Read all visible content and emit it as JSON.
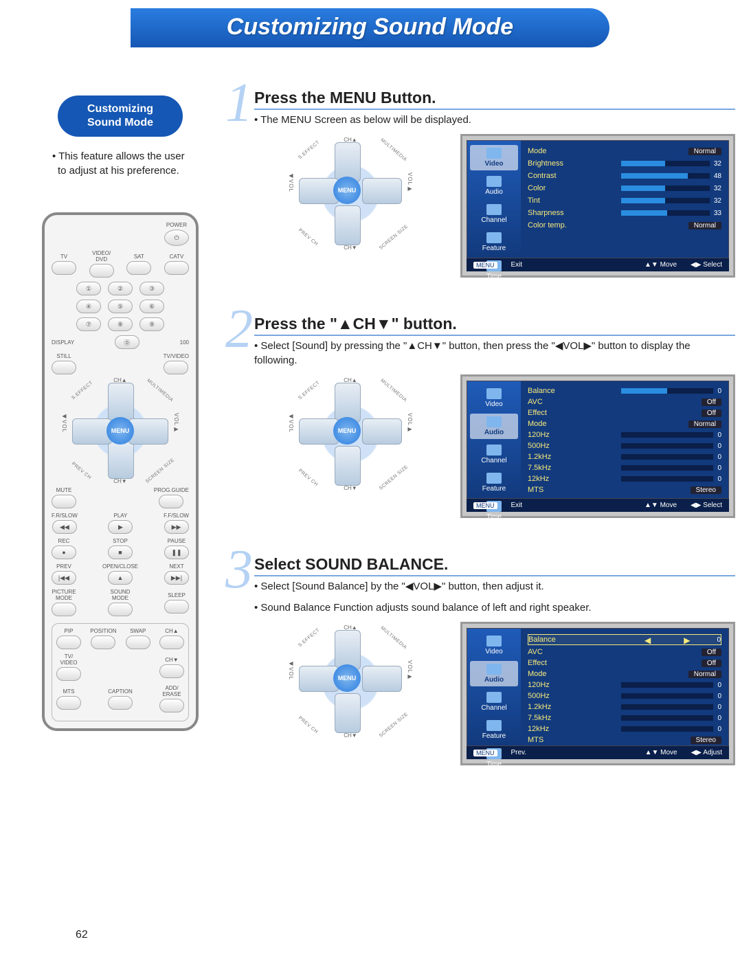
{
  "title": "Customizing Sound Mode",
  "page_number": "62",
  "sidebar": {
    "heading_line1": "Customizing",
    "heading_line2": "Sound Mode",
    "description": "• This feature allows the user to adjust at his preference."
  },
  "remote": {
    "power": "POWER",
    "source_row": [
      "TV",
      "VIDEO/\nDVD",
      "SAT",
      "CATV"
    ],
    "display": "DISPLAY",
    "hundred": "100",
    "still": "STILL",
    "tvvideo": "TV/VIDEO",
    "menu": "MENU",
    "mute": "MUTE",
    "progguide": "PROG.GUIDE",
    "transport_row1": [
      "F.R/SLOW",
      "PLAY",
      "F.F/SLOW"
    ],
    "transport_row2": [
      "REC",
      "STOP",
      "PAUSE"
    ],
    "transport_row3": [
      "PREV",
      "OPEN/CLOSE",
      "NEXT"
    ],
    "mode_row": [
      "PICTURE\nMODE",
      "SOUND\nMODE",
      "SLEEP"
    ],
    "pip_row1": [
      "PIP",
      "POSITION",
      "SWAP",
      "CH▲"
    ],
    "pip_center": "TV/\nVIDEO",
    "pip_row2_right": "CH▼",
    "bottom_row": [
      "MTS",
      "CAPTION",
      "ADD/\nERASE"
    ],
    "dpad_labels": {
      "t": "CH▲",
      "b": "CH▼",
      "lv": "◀VOL",
      "rv": "VOL▶",
      "tl": "S.EFFECT",
      "tr": "MULTIMEDIA",
      "bl": "PREV CH",
      "br": "SCREEN SIZE"
    }
  },
  "steps": [
    {
      "num": "1",
      "title": "Press the MENU Button.",
      "text": "• The MENU Screen as below will be displayed.",
      "osd": {
        "active_tab": "Video",
        "tabs": [
          "Video",
          "Audio",
          "Channel",
          "Feature",
          "Time"
        ],
        "rows": [
          {
            "lbl": "Mode",
            "pill": "Normal"
          },
          {
            "lbl": "Brightness",
            "slider": 50,
            "val": "32"
          },
          {
            "lbl": "Contrast",
            "slider": 75,
            "val": "48"
          },
          {
            "lbl": "Color",
            "slider": 50,
            "val": "32"
          },
          {
            "lbl": "Tint",
            "slider": 50,
            "val": "32"
          },
          {
            "lbl": "Sharpness",
            "slider": 52,
            "val": "33"
          },
          {
            "lbl": "Color  temp.",
            "pill": "Normal"
          }
        ],
        "foot": {
          "menu": "MENU",
          "exit": "Exit",
          "move": "Move",
          "select": "Select",
          "right_mode": "Select"
        }
      }
    },
    {
      "num": "2",
      "title": "Press the \"▲CH▼\" button.",
      "text": "• Select [Sound] by pressing the \"▲CH▼\" button, then press the \"◀VOL▶\" button to display the following.",
      "osd": {
        "active_tab": "Audio",
        "tabs": [
          "Video",
          "Audio",
          "Channel",
          "Feature",
          "Time"
        ],
        "rows": [
          {
            "lbl": "Balance",
            "slider": 50,
            "val": "0"
          },
          {
            "lbl": "AVC",
            "pill": "Off"
          },
          {
            "lbl": "Effect",
            "pill": "Off"
          },
          {
            "lbl": "Mode",
            "pill": "Normal"
          },
          {
            "lbl": "120Hz",
            "slider": 0,
            "val": "0"
          },
          {
            "lbl": "500Hz",
            "slider": 0,
            "val": "0"
          },
          {
            "lbl": "1.2kHz",
            "slider": 0,
            "val": "0"
          },
          {
            "lbl": "7.5kHz",
            "slider": 0,
            "val": "0"
          },
          {
            "lbl": "12kHz",
            "slider": 0,
            "val": "0"
          },
          {
            "lbl": "MTS",
            "pill": "Stereo"
          }
        ],
        "foot": {
          "menu": "MENU",
          "exit": "Exit",
          "move": "Move",
          "select": "Select",
          "right_mode": "Select"
        }
      }
    },
    {
      "num": "3",
      "title": "Select SOUND BALANCE.",
      "text": "• Select [Sound Balance] by the \"◀VOL▶\" button, then adjust it.",
      "text2": "• Sound Balance Function adjusts sound balance of left and right speaker.",
      "osd": {
        "active_tab": "Audio",
        "tabs": [
          "Video",
          "Audio",
          "Channel",
          "Feature",
          "Time"
        ],
        "rows": [
          {
            "lbl": "Balance",
            "arrows": true,
            "val": "0",
            "sel": true
          },
          {
            "lbl": "AVC",
            "pill": "Off"
          },
          {
            "lbl": "Effect",
            "pill": "Off"
          },
          {
            "lbl": "Mode",
            "pill": "Normal"
          },
          {
            "lbl": "120Hz",
            "slider": 0,
            "val": "0"
          },
          {
            "lbl": "500Hz",
            "slider": 0,
            "val": "0"
          },
          {
            "lbl": "1.2kHz",
            "slider": 0,
            "val": "0"
          },
          {
            "lbl": "7.5kHz",
            "slider": 0,
            "val": "0"
          },
          {
            "lbl": "12kHz",
            "slider": 0,
            "val": "0"
          },
          {
            "lbl": "MTS",
            "pill": "Stereo"
          }
        ],
        "foot": {
          "menu": "MENU",
          "exit": "Prev.",
          "move": "Move",
          "select": "Adjust",
          "right_mode": "Adjust"
        }
      }
    }
  ]
}
